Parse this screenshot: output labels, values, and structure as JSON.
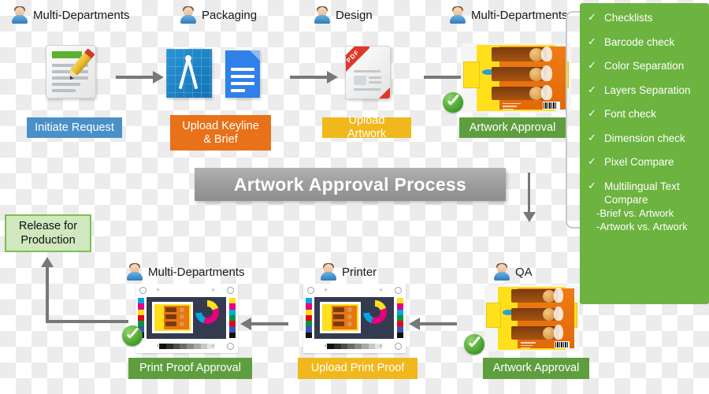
{
  "diagram": {
    "title": "Artwork Approval Process",
    "actors": {
      "multi_departments": "Multi-Departments",
      "packaging": "Packaging",
      "design": "Design",
      "printer": "Printer",
      "qa": "QA"
    },
    "top_row": [
      {
        "actor": "Multi-Departments",
        "label": "Initiate Request",
        "icon": "request-document-pencil-icon",
        "color": "#4a90c8",
        "approved": false
      },
      {
        "actor": "Packaging",
        "label": "Upload Keyline\n& Brief",
        "icon": "blueprint-compass-icon",
        "color": "#e8711a",
        "approved": false
      },
      {
        "actor": "Design",
        "label": "Upload Artwork",
        "icon": "pdf-document-icon",
        "color": "#f0b81c",
        "approved": false
      },
      {
        "actor": "Multi-Departments",
        "label": "Artwork Approval",
        "icon": "artwork-carton-icon",
        "color": "#5f9e3f",
        "approved": true
      }
    ],
    "bottom_row": [
      {
        "actor": "Multi-Departments",
        "label": "Print Proof Approval",
        "icon": "print-proof-icon",
        "color": "#5f9e3f",
        "approved": true
      },
      {
        "actor": "Printer",
        "label": "Upload Print Proof",
        "icon": "print-proof-icon",
        "color": "#f0b81c",
        "approved": false
      },
      {
        "actor": "QA",
        "label": "Artwork Approval",
        "icon": "artwork-carton-icon",
        "color": "#5f9e3f",
        "approved": true
      }
    ],
    "release": {
      "label": "Release for\nProduction",
      "fill": "#cfe8bd",
      "border": "#7dbf52"
    },
    "pdf_ribbon_text": "PDF"
  },
  "checklist": {
    "panel_color": "#6cb33f",
    "tick": "✓",
    "items": [
      {
        "label": "Checklists",
        "sub": ""
      },
      {
        "label": "Barcode check",
        "sub": ""
      },
      {
        "label": "Color Separation",
        "sub": ""
      },
      {
        "label": "Layers Separation",
        "sub": ""
      },
      {
        "label": "Font check",
        "sub": ""
      },
      {
        "label": "Dimension check",
        "sub": ""
      },
      {
        "label": "Pixel Compare",
        "sub": ""
      },
      {
        "label": "Multilingual Text\nCompare",
        "sub": "-Brief vs. Artwork\n-Artwork vs. Artwork"
      }
    ]
  }
}
